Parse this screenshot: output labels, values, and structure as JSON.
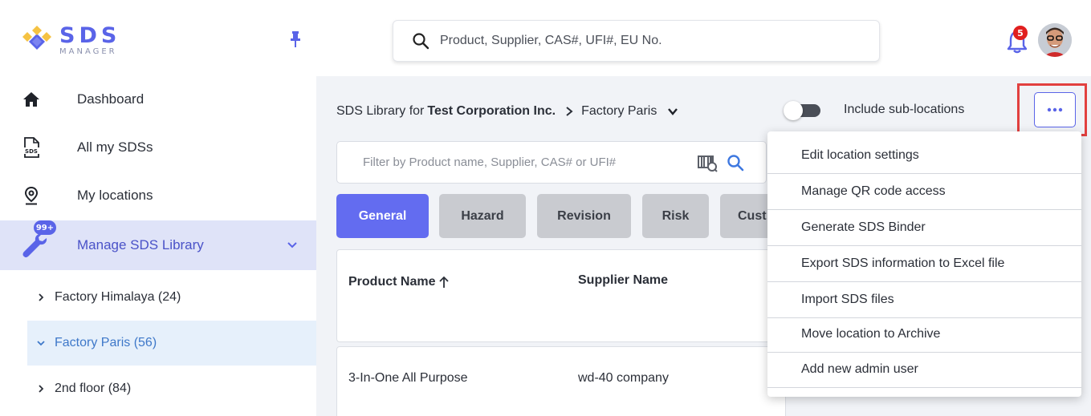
{
  "brand": {
    "title": "SDS",
    "subtitle": "MANAGER",
    "accent_color": "#5a64e8"
  },
  "header": {
    "search_placeholder": "Product, Supplier, CAS#, UFI#, EU No.",
    "notification_count": "5",
    "icons": [
      "pin-icon",
      "search-icon",
      "bell-icon",
      "avatar"
    ]
  },
  "sidebar": {
    "items": [
      {
        "label": "Dashboard",
        "icon": "home-icon"
      },
      {
        "label": "All my SDSs",
        "icon": "sds-document-icon"
      },
      {
        "label": "My locations",
        "icon": "location-pin-icon"
      },
      {
        "label": "Manage SDS Library",
        "icon": "wrench-icon",
        "badge": "99+",
        "active": true
      }
    ],
    "tree": [
      {
        "label": "Factory Himalaya (24)",
        "expanded": false
      },
      {
        "label": "Factory Paris (56)",
        "expanded": true,
        "active": true
      },
      {
        "label": "2nd floor (84)",
        "expanded": false
      }
    ]
  },
  "main": {
    "breadcrumb": {
      "prefix": "SDS Library for",
      "company": "Test Corporation Inc.",
      "location": "Factory Paris"
    },
    "include_sub_locations_label": "Include sub-locations",
    "include_sub_locations_on": false,
    "filter_placeholder": "Filter by Product name, Supplier, CAS# or UFI#",
    "tabs": [
      "General",
      "Hazard",
      "Revision",
      "Risk",
      "Cust"
    ],
    "active_tab": "General",
    "table": {
      "columns": [
        "Product Name",
        "Supplier Name"
      ],
      "sort_column": "Product Name",
      "rows": [
        {
          "product": "3-In-One All Purpose",
          "supplier": "wd-40 company"
        }
      ]
    }
  },
  "more_menu": {
    "items": [
      "Edit location settings",
      "Manage QR code access",
      "Generate SDS Binder",
      "Export SDS information to Excel file",
      "Import SDS files",
      "Move location to Archive",
      "Add new admin user"
    ]
  }
}
